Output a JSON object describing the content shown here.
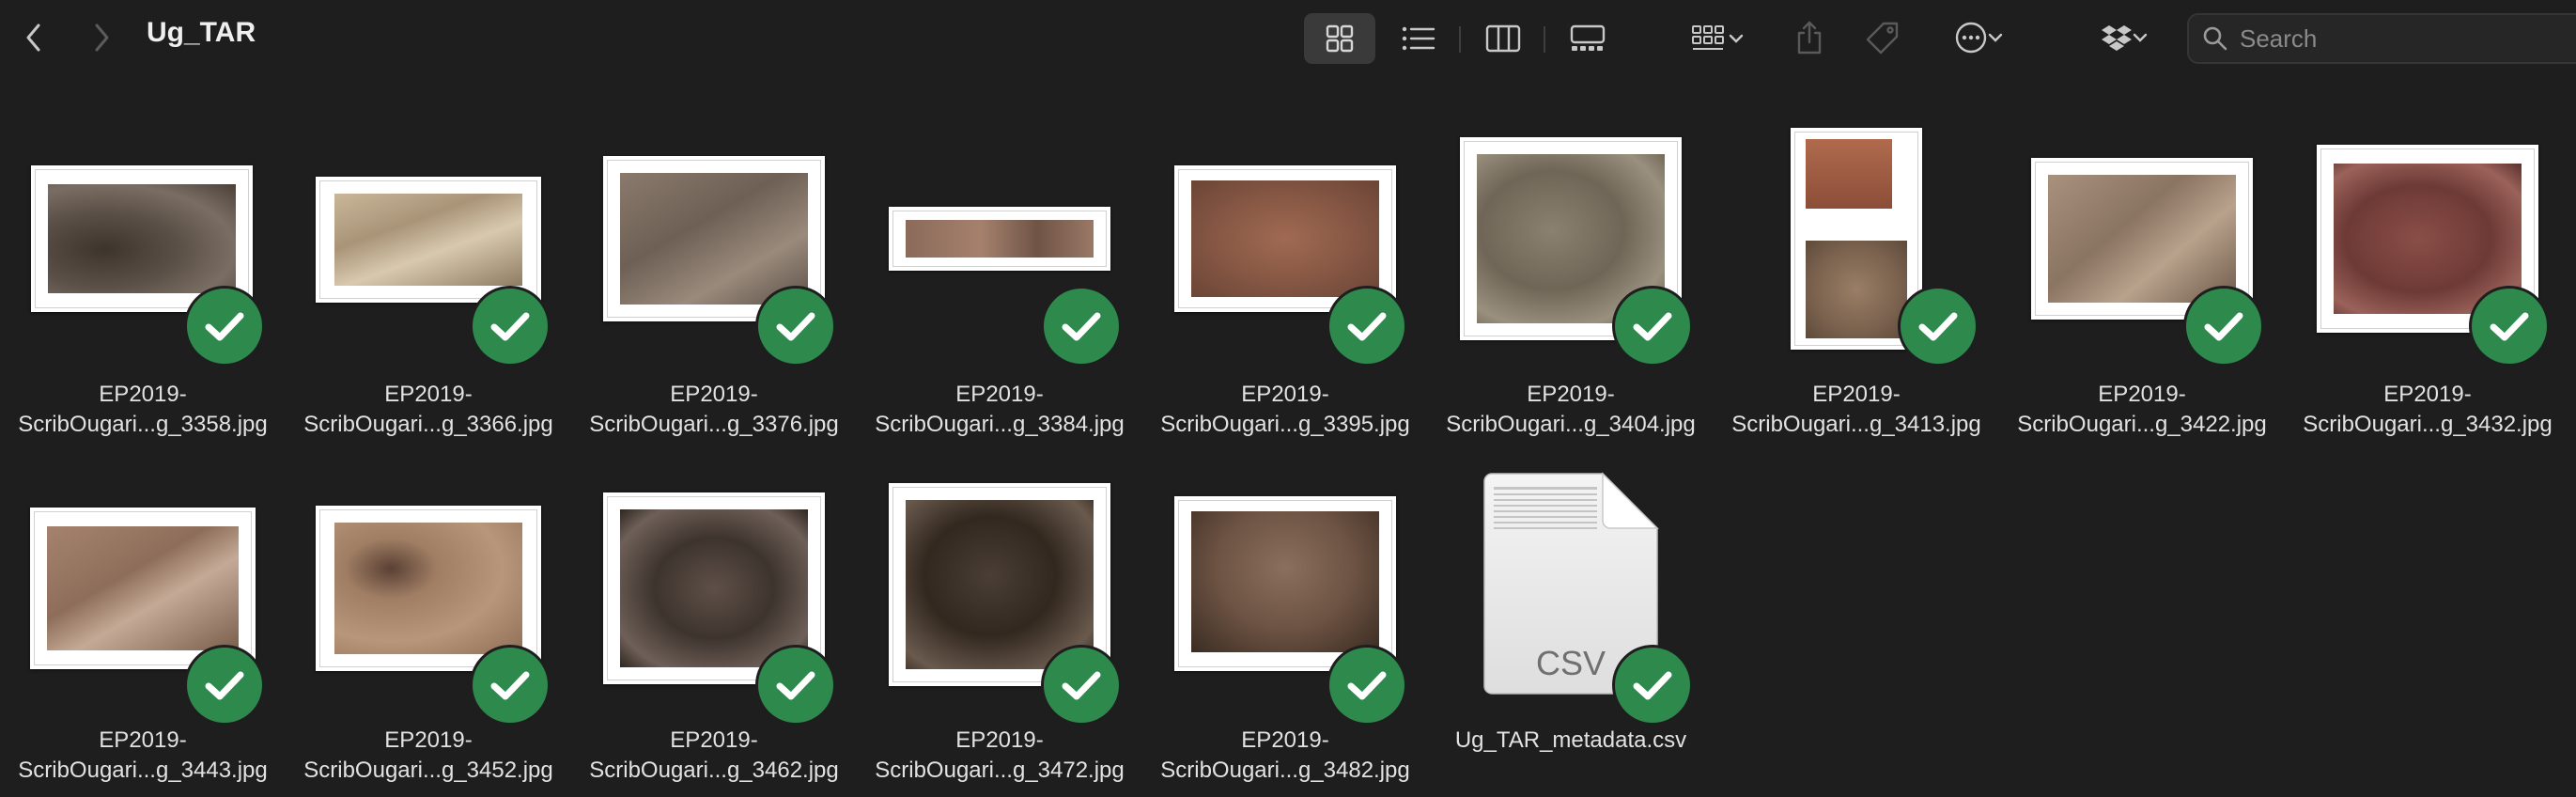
{
  "window": {
    "title": "Ug_TAR",
    "search": {
      "placeholder": "Search",
      "value": ""
    }
  },
  "toolbar": {
    "icons": [
      "chevron-left-icon",
      "chevron-right-icon",
      "icon-view-icon",
      "list-view-icon",
      "column-view-icon",
      "gallery-view-icon",
      "group-icon",
      "share-icon",
      "tag-icon",
      "more-actions-icon",
      "dropbox-icon",
      "search-icon"
    ],
    "active_view": "icon-view"
  },
  "files": [
    {
      "line1": "EP2019-",
      "line2": "ScribOugari...g_3358.jpg",
      "synced": true
    },
    {
      "line1": "EP2019-",
      "line2": "ScribOugari...g_3366.jpg",
      "synced": true
    },
    {
      "line1": "EP2019-",
      "line2": "ScribOugari...g_3376.jpg",
      "synced": true
    },
    {
      "line1": "EP2019-",
      "line2": "ScribOugari...g_3384.jpg",
      "synced": true
    },
    {
      "line1": "EP2019-",
      "line2": "ScribOugari...g_3395.jpg",
      "synced": true
    },
    {
      "line1": "EP2019-",
      "line2": "ScribOugari...g_3404.jpg",
      "synced": true
    },
    {
      "line1": "EP2019-",
      "line2": "ScribOugari...g_3413.jpg",
      "synced": true
    },
    {
      "line1": "EP2019-",
      "line2": "ScribOugari...g_3422.jpg",
      "synced": true
    },
    {
      "line1": "EP2019-",
      "line2": "ScribOugari...g_3432.jpg",
      "synced": true
    },
    {
      "line1": "EP2019-",
      "line2": "ScribOugari...g_3443.jpg",
      "synced": true
    },
    {
      "line1": "EP2019-",
      "line2": "ScribOugari...g_3452.jpg",
      "synced": true
    },
    {
      "line1": "EP2019-",
      "line2": "ScribOugari...g_3462.jpg",
      "synced": true
    },
    {
      "line1": "EP2019-",
      "line2": "ScribOugari...g_3472.jpg",
      "synced": true
    },
    {
      "line1": "EP2019-",
      "line2": "ScribOugari...g_3482.jpg",
      "synced": true
    },
    {
      "line1": "Ug_TAR_metadata.csv",
      "line2": "",
      "synced": true,
      "doc_badge": "CSV"
    }
  ],
  "colors": {
    "background": "#1e1e1e",
    "sync_badge": "#2e8a4c",
    "text": "#e2e2e2"
  }
}
